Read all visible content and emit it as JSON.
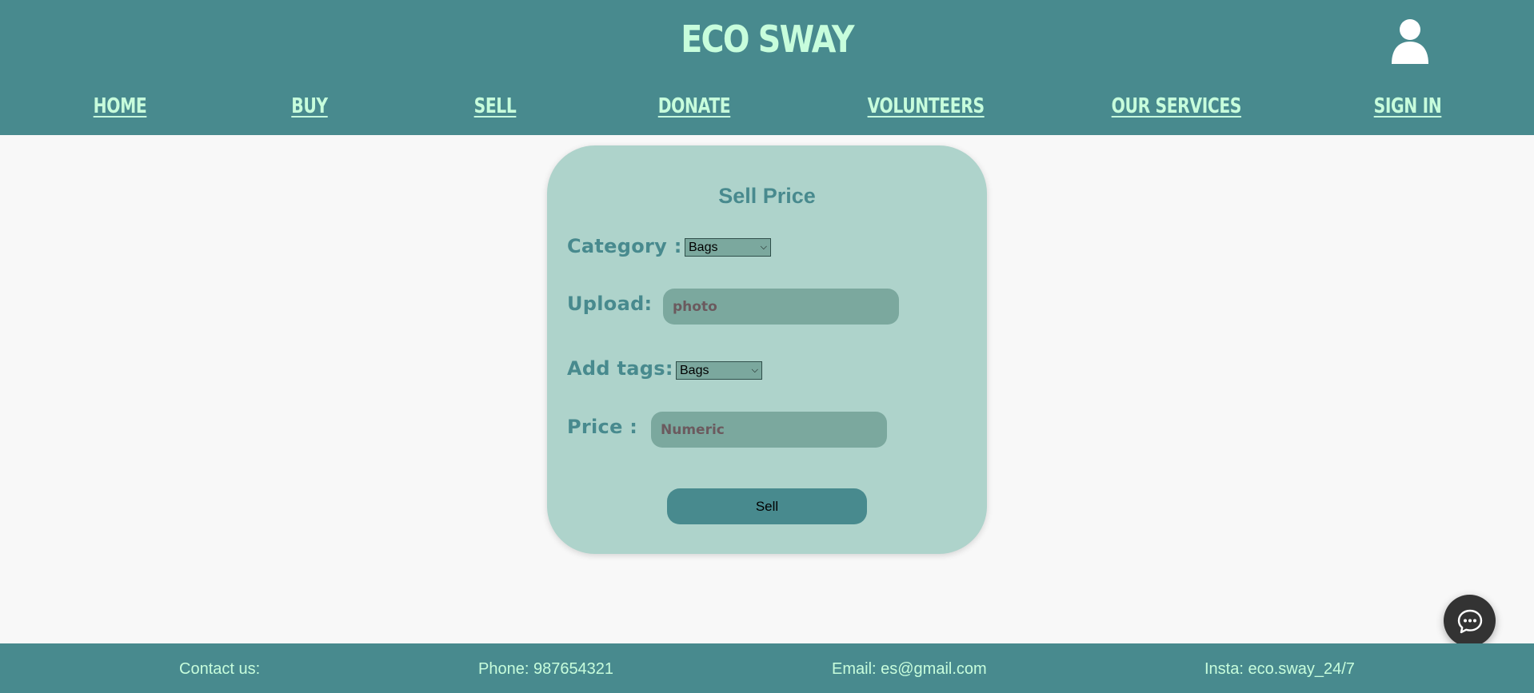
{
  "header": {
    "brand": "ECO SWAY",
    "profile_icon": "user-icon"
  },
  "nav": {
    "items": [
      {
        "label": "HOME"
      },
      {
        "label": "BUY"
      },
      {
        "label": "SELL"
      },
      {
        "label": "DONATE"
      },
      {
        "label": "VOLUNTEERS"
      },
      {
        "label": "OUR SERVICES"
      },
      {
        "label": "SIGN IN"
      }
    ]
  },
  "form": {
    "title": "Sell Price",
    "category": {
      "label": "Category :",
      "selected": "Bags"
    },
    "upload": {
      "label": "Upload:",
      "placeholder": "photo"
    },
    "tags": {
      "label": "Add tags:",
      "selected": "Bags"
    },
    "price": {
      "label": "Price :",
      "placeholder": "Numeric"
    },
    "submit_label": "Sell"
  },
  "chat": {
    "icon": "chat-bubble-icon"
  },
  "footer": {
    "contact": "Contact us:",
    "phone": "Phone: 987654321",
    "email": "Email: es@gmail.com",
    "insta": "Insta: eco.sway_24/7"
  },
  "colors": {
    "header_bg": "#488a8e",
    "accent_text": "#c7fddc",
    "card_bg": "#aed3cb",
    "field_bg": "#7ba89e",
    "label_text": "#488a8e",
    "chat_bg": "#333333"
  }
}
